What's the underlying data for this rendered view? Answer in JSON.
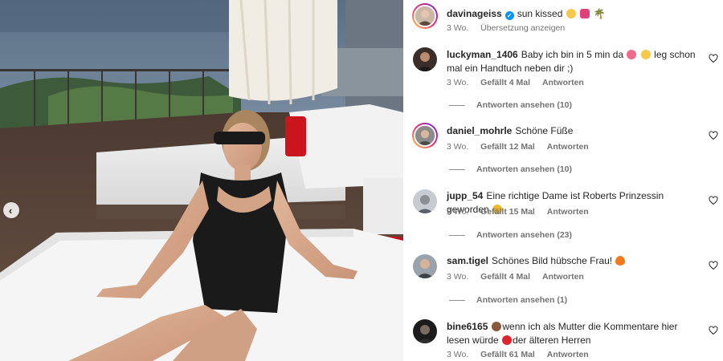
{
  "caption": {
    "username": "davinageiss",
    "text": "sun kissed",
    "time": "3 Wo.",
    "translate_label": "Übersetzung anzeigen"
  },
  "comments": [
    {
      "username": "luckyman_1406",
      "text_a": "Baby ich bin in 5 min da",
      "text_b": "leg schon mal ein Handtuch neben dir ;)",
      "time": "3 Wo.",
      "likes": "Gefällt 4 Mal",
      "reply_label": "Antworten",
      "view_replies": "Antworten ansehen (10)"
    },
    {
      "username": "daniel_mohrle",
      "text_a": "Schöne Füße",
      "time": "3 Wo.",
      "likes": "Gefällt 12 Mal",
      "reply_label": "Antworten",
      "view_replies": "Antworten ansehen (10)"
    },
    {
      "username": "jupp_54",
      "text_a": "Eine richtige Dame ist Roberts Prinzessin geworden",
      "time": "3 Wo.",
      "likes": "Gefällt 15 Mal",
      "reply_label": "Antworten",
      "view_replies": "Antworten ansehen (23)"
    },
    {
      "username": "sam.tigel",
      "text_a": "Schönes Bild hübsche Frau!",
      "time": "3 Wo.",
      "likes": "Gefällt 4 Mal",
      "reply_label": "Antworten",
      "view_replies": "Antworten ansehen (1)"
    },
    {
      "username": "bine6165",
      "text_a": "wenn ich als Mutter die Kommentare hier lesen würde",
      "text_b": "der älteren Herren",
      "time": "3 Wo.",
      "likes": "Gefällt 61 Mal",
      "reply_label": "Antworten"
    }
  ],
  "icons": {
    "verified": "verified-badge-icon",
    "heart": "heart-outline-icon",
    "prev": "chevron-left-icon"
  }
}
